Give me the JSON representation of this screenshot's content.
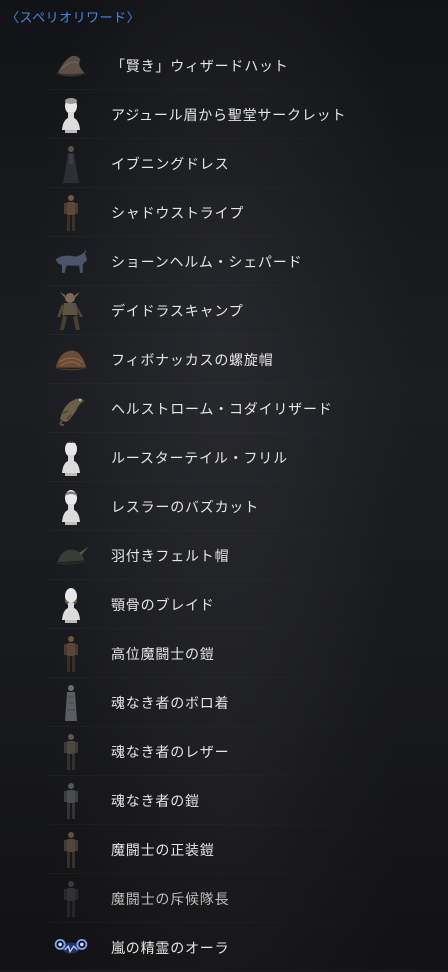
{
  "header": {
    "title": "〈スペリオリワード〉"
  },
  "items": [
    {
      "label": "「賢き」ウィザードハット",
      "icon": "wizard-hat-icon"
    },
    {
      "label": "アジュール眉から聖堂サークレット",
      "icon": "white-mannequin-bust-icon"
    },
    {
      "label": "イブニングドレス",
      "icon": "dark-dress-figure-icon"
    },
    {
      "label": "シャドウストライプ",
      "icon": "armored-figure-icon"
    },
    {
      "label": "ショーンヘルム・シェパード",
      "icon": "wolf-icon"
    },
    {
      "label": "デイドラスキャンプ",
      "icon": "creature-figure-icon"
    },
    {
      "label": "フィボナッカスの螺旋帽",
      "icon": "brown-hat-icon"
    },
    {
      "label": "ヘルストローム・コダイリザード",
      "icon": "lizard-icon"
    },
    {
      "label": "ルースターテイル・フリル",
      "icon": "white-mannequin-bust-icon"
    },
    {
      "label": "レスラーのバズカット",
      "icon": "white-mannequin-head-icon"
    },
    {
      "label": "羽付きフェルト帽",
      "icon": "feather-hat-icon"
    },
    {
      "label": "顎骨のブレイド",
      "icon": "white-mannequin-bust-icon"
    },
    {
      "label": "高位魔闘士の鎧",
      "icon": "armored-figure-icon"
    },
    {
      "label": "魂なき者のボロ着",
      "icon": "robed-figure-icon"
    },
    {
      "label": "魂なき者のレザー",
      "icon": "armored-figure-icon"
    },
    {
      "label": "魂なき者の鎧",
      "icon": "armored-figure-icon"
    },
    {
      "label": "魔闘士の正装鎧",
      "icon": "armored-figure-icon"
    },
    {
      "label": "魔闘士の斥候隊長",
      "icon": "dark-figure-icon"
    },
    {
      "label": "嵐の精霊のオーラ",
      "icon": "storm-aura-icon"
    }
  ],
  "colors": {
    "header": "#4a86e8",
    "text": "#e6e6e6",
    "background": "#16181c"
  }
}
